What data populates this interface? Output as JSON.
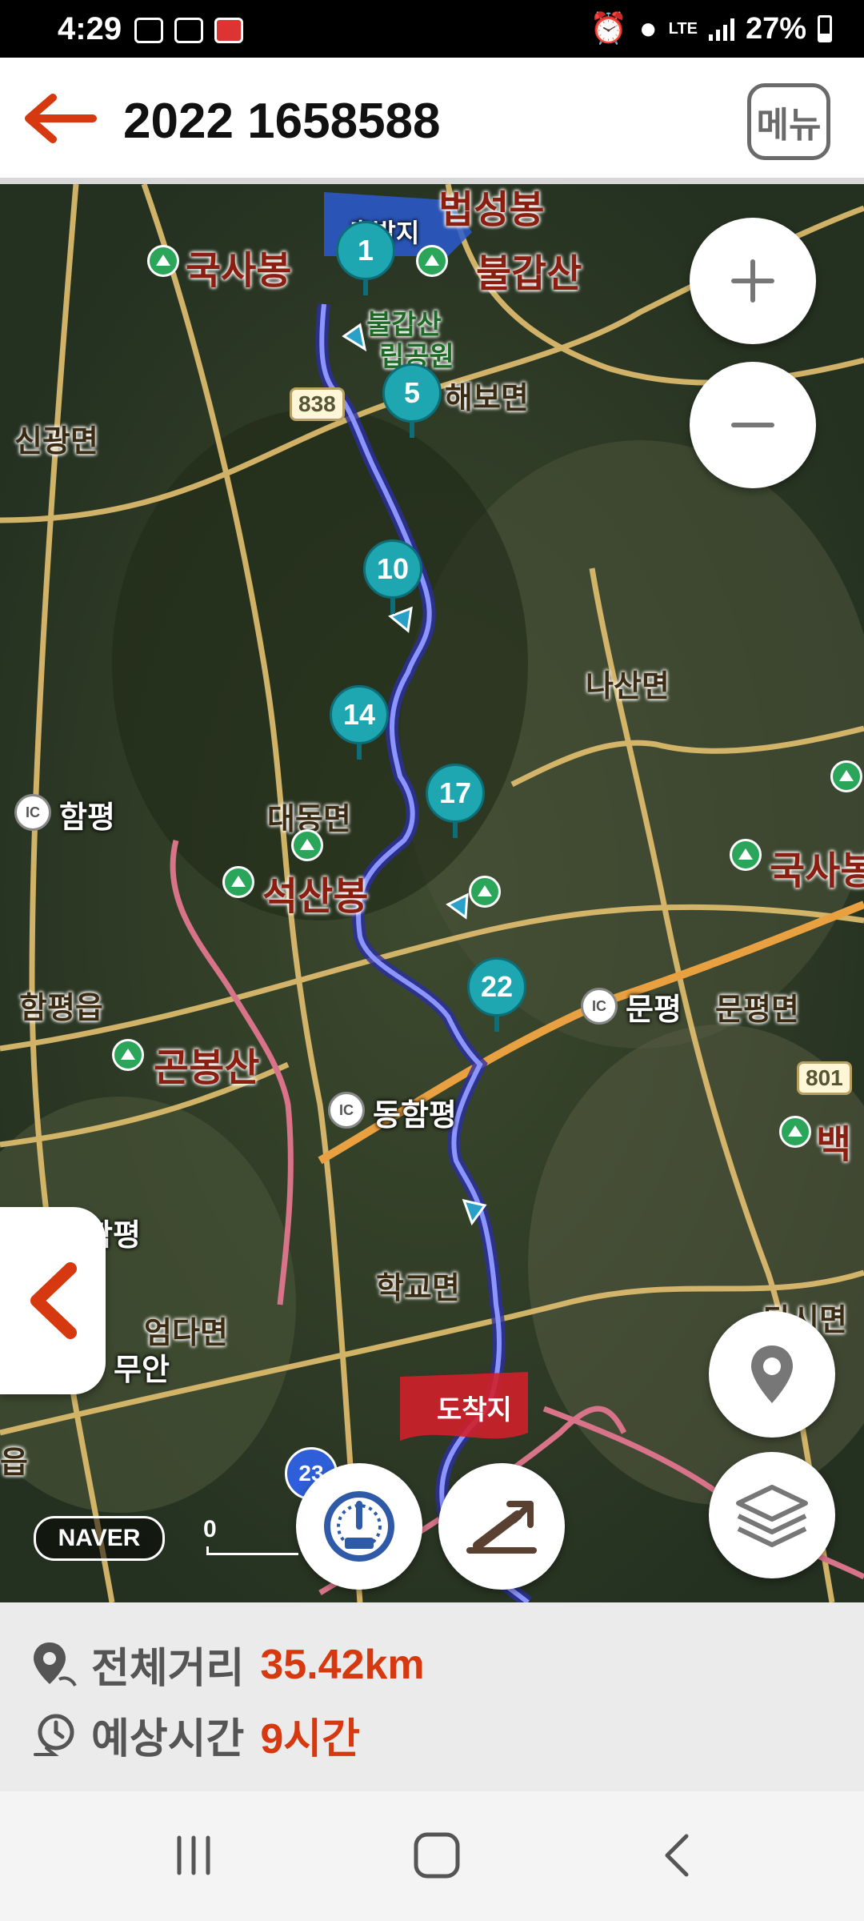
{
  "status_bar": {
    "time": "4:29",
    "network": "LTE",
    "battery": "27%"
  },
  "header": {
    "title": "2022 1658588",
    "menu_label": "메뉴"
  },
  "map": {
    "places": {
      "gooksabong": "국사봉",
      "beopseongbong": "법성봉",
      "bulgapsan": "불갑산",
      "bulgapsan_park_1": "불갑산",
      "bulgapsan_park_2": "립공원",
      "haebomyeon": "해보면",
      "singwangmyeon": "신광면",
      "nasanmyeon": "나산면",
      "hampyeong": "함평",
      "daedongmyeon": "대동면",
      "seoksanbong": "석산봉",
      "gooksabong_east": "국사봉",
      "hampyeongeup": "함평읍",
      "munpyeong": "문평",
      "munpyeongmyeon": "문평면",
      "gonbongsan": "곤봉산",
      "donghampyeong": "동함평",
      "baek": "백",
      "hakgyomyeon": "학교면",
      "eomdamyeon": "엄다면",
      "hampyeong_ic2": "함평",
      "muan": "무안",
      "dasimyeon": "다시면",
      "eup": "읍",
      "start_label": "출발지",
      "end_label": "도착지"
    },
    "ic_label": "IC",
    "road_numbers": [
      "838",
      "801",
      "23"
    ],
    "waypoints": [
      "1",
      "5",
      "10",
      "14",
      "17",
      "22"
    ],
    "naver_logo": "NAVER",
    "scale_label": "0",
    "colors": {
      "route": "#3a3fd0",
      "waypoint": "#1ea7b0",
      "accent": "#d6390f"
    }
  },
  "info": {
    "distance_label": "전체거리",
    "distance_value": "35.42km",
    "time_label": "예상시간",
    "time_value": "9시간"
  }
}
